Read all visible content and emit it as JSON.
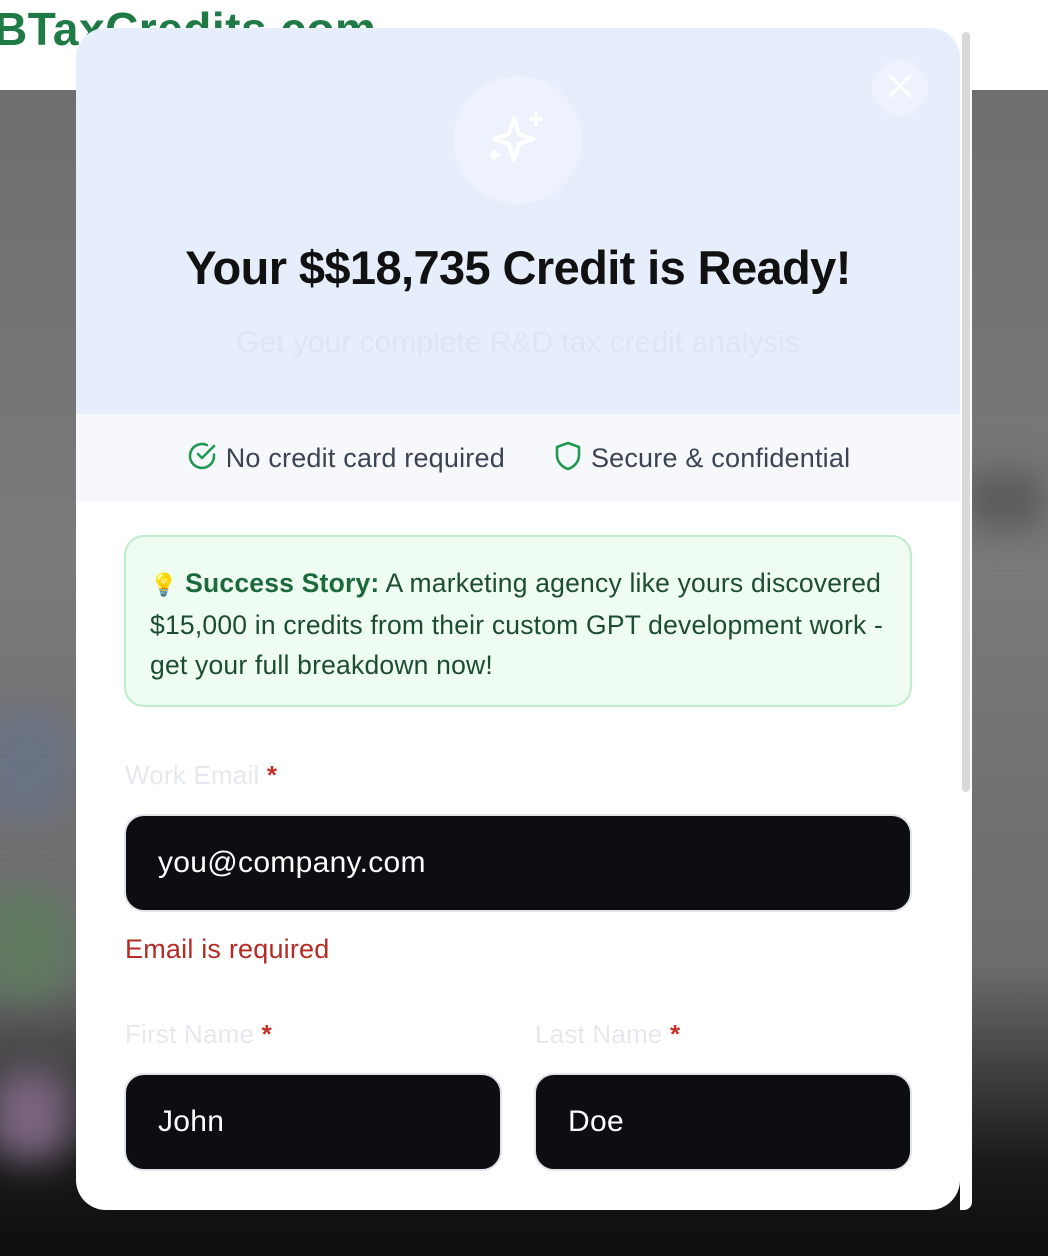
{
  "background": {
    "site_logo": "BTaxCredits.com"
  },
  "modal": {
    "close_icon": "close-icon",
    "sparkle_icon": "sparkles-icon",
    "title": "Your $$18,735 Credit is Ready!",
    "subtitle": "Get your complete R&D tax credit analysis",
    "trust": [
      {
        "icon": "check-circle-icon",
        "label": "No credit card required"
      },
      {
        "icon": "shield-icon",
        "label": "Secure & confidential"
      }
    ],
    "success_story": {
      "icon": "lightbulb-icon",
      "heading": "Success Story:",
      "text": " A marketing agency like yours discovered $15,000 in credits from their custom GPT development work - get your full breakdown now!"
    },
    "form": {
      "email": {
        "label": "Work Email",
        "required_mark": "*",
        "value": "you@company.com",
        "error": "Email is required"
      },
      "first_name": {
        "label": "First Name",
        "required_mark": "*",
        "value": "John"
      },
      "last_name": {
        "label": "Last Name",
        "required_mark": "*",
        "value": "Doe"
      }
    }
  },
  "colors": {
    "brand_green": "#1f7a45",
    "hero_bg": "#e6eefc",
    "error_red": "#b42b24",
    "input_bg": "#0d0d12"
  }
}
